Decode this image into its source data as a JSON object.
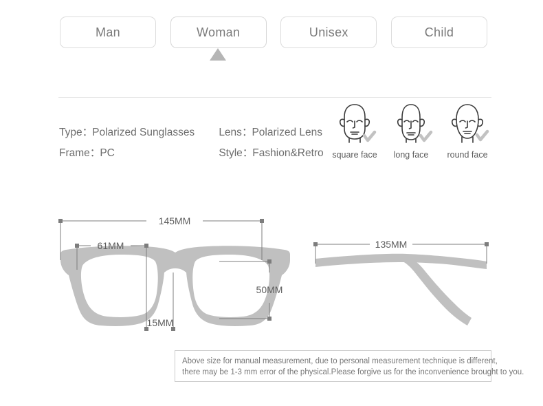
{
  "tabs": {
    "items": [
      {
        "label": "Man",
        "active": false
      },
      {
        "label": "Woman",
        "active": true
      },
      {
        "label": "Unisex",
        "active": false
      },
      {
        "label": "Child",
        "active": false
      }
    ],
    "active_marker_icon": "triangle-up-icon"
  },
  "specs": {
    "separator": "：",
    "rows": [
      [
        {
          "key": "Type",
          "value": "Polarized Sunglasses"
        },
        {
          "key": "Lens",
          "value": "Polarized Lens"
        }
      ],
      [
        {
          "key": "Frame",
          "value": "PC"
        },
        {
          "key": "Style",
          "value": "Fashion&Retro"
        }
      ]
    ]
  },
  "faces": {
    "items": [
      {
        "label": "square face",
        "icon": "square-face-icon",
        "check": "check-icon"
      },
      {
        "label": "long face",
        "icon": "long-face-icon",
        "check": "check-icon"
      },
      {
        "label": "round face",
        "icon": "round-face-icon",
        "check": "check-icon"
      }
    ]
  },
  "measurements": {
    "front": {
      "total_width": "145MM",
      "lens_span": "61MM",
      "lens_height": "50MM",
      "bridge": "15MM"
    },
    "temple": {
      "length": "135MM"
    }
  },
  "disclaimer": {
    "line1": "Above size for manual measurement, due to personal measurement technique is different,",
    "line2": "there may be 1-3 mm error of the physical.Please forgive us for the inconvenience brought to you."
  },
  "colors": {
    "frame_gray": "#c0c0c0",
    "dimension_line": "#7d7d7d",
    "tab_border": "#dcdcdc",
    "marker_gray": "#b5b5b5",
    "text_gray": "#6d6d6d"
  }
}
